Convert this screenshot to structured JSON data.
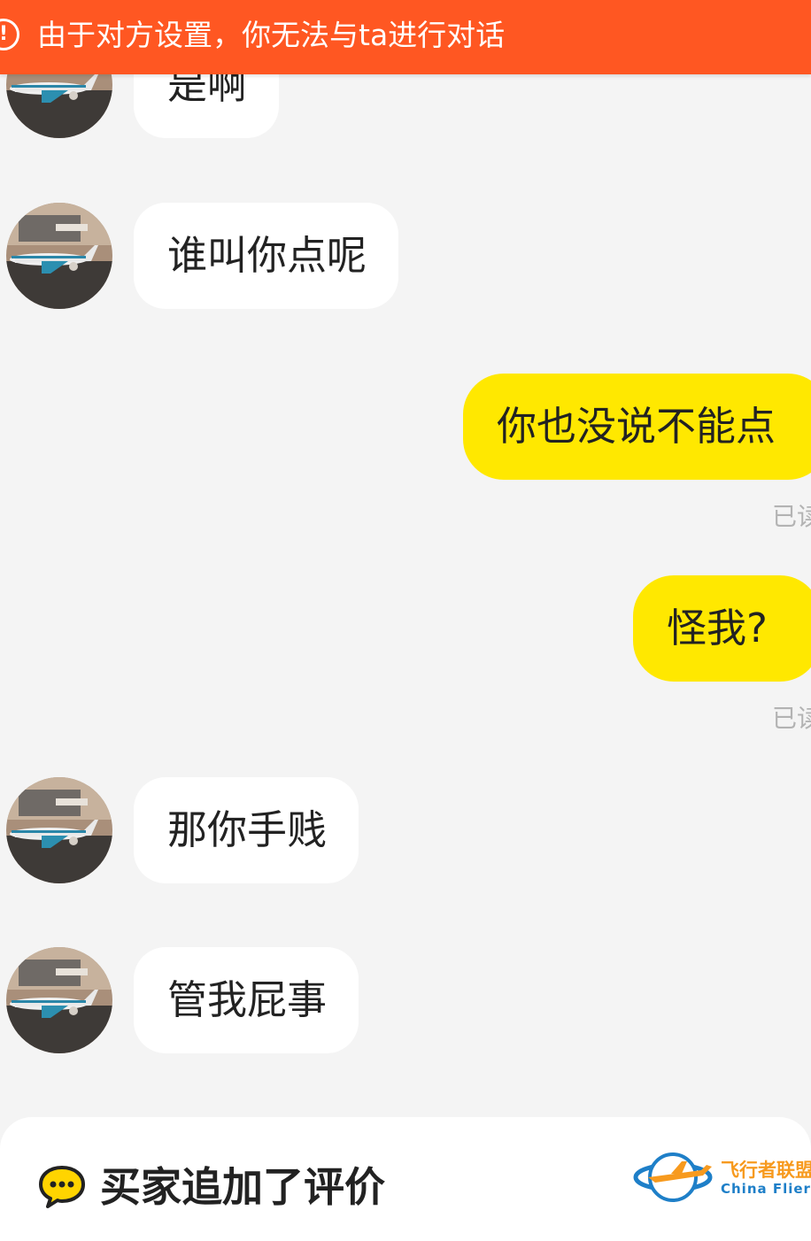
{
  "banner": {
    "text": "由于对方设置，你无法与ta进行对话",
    "icon": "alert-circle-icon",
    "color": "#ff5722"
  },
  "messages": [
    {
      "side": "in",
      "text": "是啊"
    },
    {
      "side": "in",
      "text": "谁叫你点呢"
    },
    {
      "side": "out",
      "text": "你也没说不能点",
      "status": "已读"
    },
    {
      "side": "out",
      "text": "怪我?",
      "status": "已读"
    },
    {
      "side": "in",
      "text": "那你手贱"
    },
    {
      "side": "in",
      "text": "管我屁事"
    }
  ],
  "bottom_card": {
    "icon": "chat-bubble-icon",
    "title": "买家追加了评价"
  },
  "watermark": {
    "name_cn": "飞行者联盟",
    "name_en": "China Flier"
  },
  "colors": {
    "background": "#f4f4f4",
    "incoming_bubble": "#ffffff",
    "outgoing_bubble": "#ffe800",
    "read_status": "#b3b3b3"
  }
}
